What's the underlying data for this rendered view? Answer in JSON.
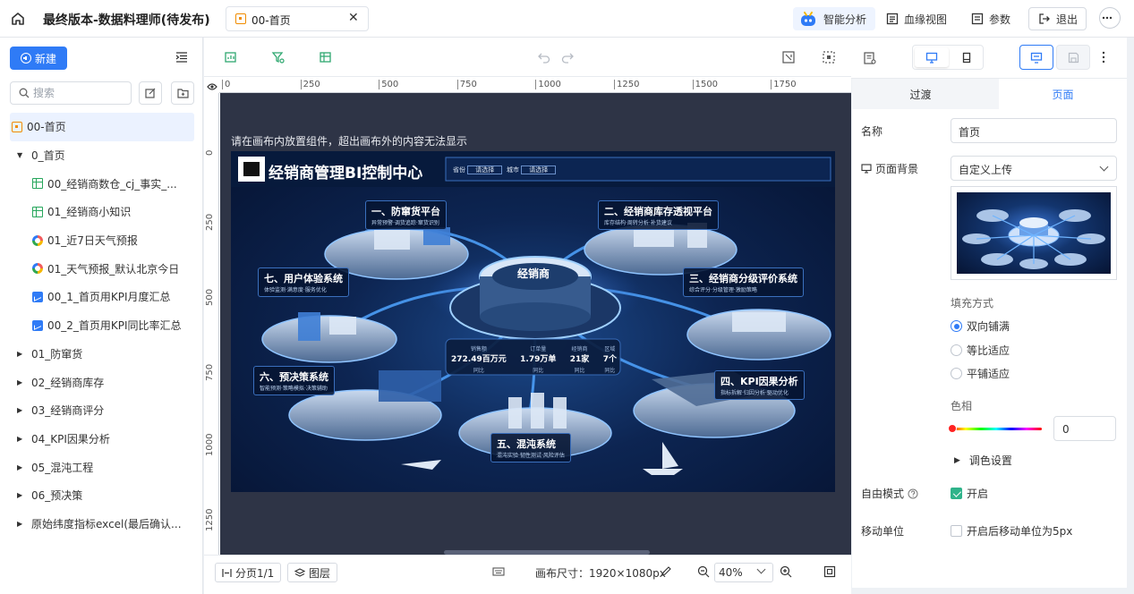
{
  "topbar": {
    "title": "最终版本-数据料理师(待发布)",
    "tab_label": "00-首页",
    "tab_close": "✕",
    "ai_label": "智能分析",
    "lineage_label": "血缘视图",
    "params_label": "参数",
    "logout_label": "退出"
  },
  "sidebar": {
    "new_label": "新建",
    "search_placeholder": "搜索",
    "tree": [
      {
        "label": "00-首页",
        "icon": "page-icon",
        "level": 0,
        "selected": true
      },
      {
        "label": "0_首页",
        "icon": "folder",
        "level": 0,
        "expanded": true
      },
      {
        "label": "00_经销商数仓_cj_事实_...",
        "icon": "table-icon",
        "level": 1
      },
      {
        "label": "01_经销商小知识",
        "icon": "table-icon",
        "level": 1
      },
      {
        "label": "01_近7日天气预报",
        "icon": "ring-icon",
        "level": 1
      },
      {
        "label": "01_天气预报_默认北京今日",
        "icon": "ring-icon",
        "level": 1
      },
      {
        "label": "00_1_首页用KPI月度汇总",
        "icon": "chart-icon",
        "level": 1
      },
      {
        "label": "00_2_首页用KPI同比率汇总",
        "icon": "chart-icon",
        "level": 1
      },
      {
        "label": "01_防窜货",
        "icon": "folder",
        "level": 0
      },
      {
        "label": "02_经销商库存",
        "icon": "folder",
        "level": 0
      },
      {
        "label": "03_经销商评分",
        "icon": "folder",
        "level": 0
      },
      {
        "label": "04_KPI因果分析",
        "icon": "folder",
        "level": 0
      },
      {
        "label": "05_混沌工程",
        "icon": "folder",
        "level": 0
      },
      {
        "label": "06_预决策",
        "icon": "folder",
        "level": 0
      },
      {
        "label": "原始纬度指标excel(最后确认...",
        "icon": "folder",
        "level": 0
      }
    ]
  },
  "canvas": {
    "ruler_top": [
      "0",
      "250",
      "500",
      "750",
      "1000",
      "1250",
      "1500",
      "1750"
    ],
    "ruler_left": [
      "0",
      "250",
      "500",
      "750",
      "1000",
      "1250"
    ],
    "hint": "请在画布内放置组件，超出画布外的内容无法显示",
    "dashboard": {
      "title": "经销商管理BI控制中心",
      "filter_province_label": "省份",
      "filter_province_value": "请选择",
      "filter_city_label": "城市",
      "filter_city_value": "请选择",
      "center_label": "经销商",
      "kpis": [
        {
          "value": "272.49百万元",
          "label": "销售额"
        },
        {
          "value": "1.79万单",
          "label": "订单量"
        },
        {
          "value": "21家",
          "label": "经销商"
        },
        {
          "value": "7个",
          "label": "区域"
        }
      ],
      "kpi_rate_label": "同比",
      "modules": [
        {
          "title": "一、防窜货平台",
          "sub": "异常预警·调货追踪·窜货识别"
        },
        {
          "title": "二、经销商库存透视平台",
          "sub": "库存结构·周转分析·补货建议"
        },
        {
          "title": "三、经销商分级评价系统",
          "sub": "综合评分·分级管理·激励策略"
        },
        {
          "title": "四、KPI因果分析",
          "sub": "指标拆解·归因分析·驱动优化"
        },
        {
          "title": "五、混沌系统",
          "sub": "混沌实验·韧性测试·风险评估"
        },
        {
          "title": "六、预决策系统",
          "sub": "智能预测·策略模拟·决策辅助"
        },
        {
          "title": "七、用户体验系统",
          "sub": "体验监测·满意度·服务优化"
        }
      ]
    }
  },
  "bottom": {
    "page_label": "分页1/1",
    "layer_label": "图层",
    "canvas_size": "画布尺寸：1920×1080px",
    "zoom": "40%"
  },
  "props": {
    "tab_transition": "过渡",
    "tab_page": "页面",
    "name_label": "名称",
    "name_value": "首页",
    "bg_label": "页面背景",
    "bg_value": "自定义上传",
    "fill_label": "填充方式",
    "fill_options": [
      "双向铺满",
      "等比适应",
      "平铺适应"
    ],
    "fill_selected": 0,
    "hue_label": "色相",
    "hue_value": "0",
    "color_settings": "调色设置",
    "free_mode_label": "自由模式",
    "free_mode_option": "开启",
    "free_mode_on": true,
    "move_unit_label": "移动单位",
    "move_unit_option": "开启后移动单位为5px",
    "move_unit_on": false
  },
  "colors": {
    "accent": "#2f7bf6",
    "canvas_bg": "#2e3446",
    "checkbox_on": "#2fb38a"
  }
}
